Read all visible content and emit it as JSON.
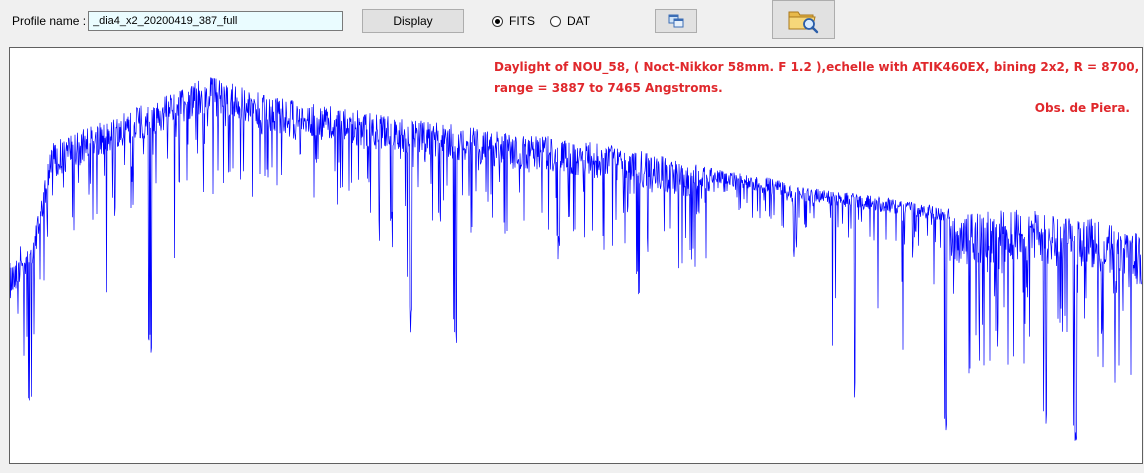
{
  "toolbar": {
    "profile_label": "Profile name :",
    "profile_value": "_dia4_x2_20200419_387_full",
    "display_label": "Display",
    "format_options": [
      {
        "label": "FITS",
        "selected": true
      },
      {
        "label": "DAT",
        "selected": false
      }
    ],
    "copy_icon": "copy-windows-icon",
    "open_icon": "folder-magnifier-icon"
  },
  "plot": {
    "annotation_line1": "Daylight of NOU_58, ( Noct-Nikkor 58mm. F 1.2 ),echelle with ATIK460EX, bining 2x2,  R = 8700,",
    "annotation_line2": "range =  3887 to 7465 Angstroms.",
    "annotation_line3": "Obs. de Piera.",
    "trace_color": "#0000ff",
    "annotation_color": "#e0282c"
  }
}
